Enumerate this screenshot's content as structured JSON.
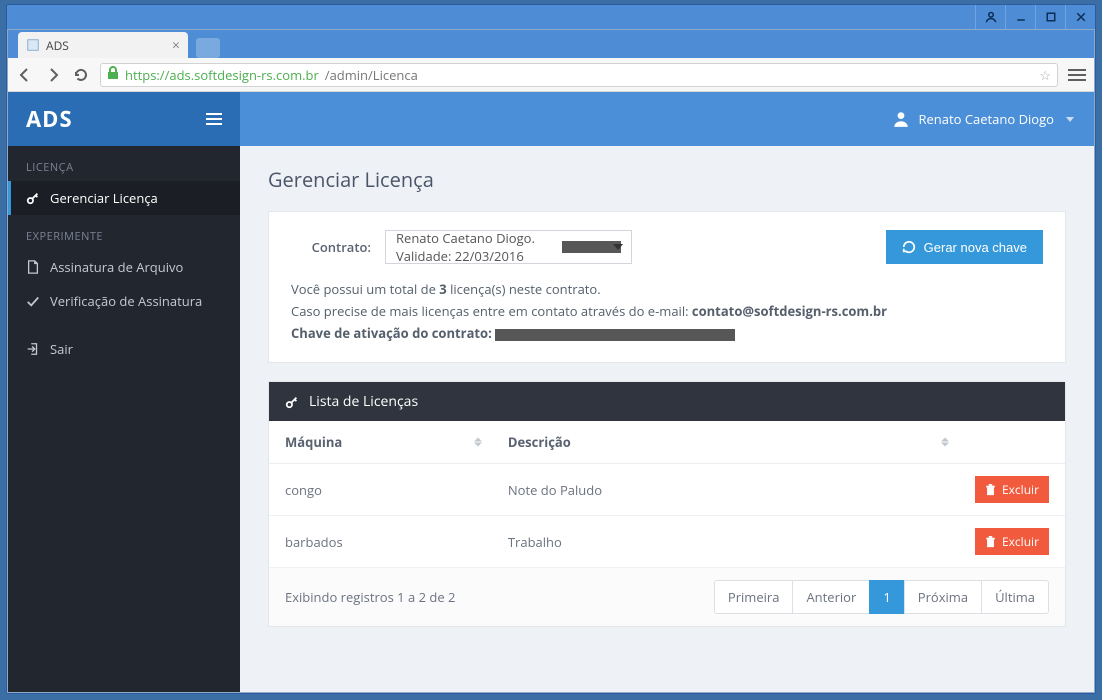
{
  "browser": {
    "tab_title": "ADS",
    "url_scheme": "https://",
    "url_host": "ads.softdesign-rs.com.br",
    "url_path": "/admin/Licenca"
  },
  "brand": "ADS",
  "user_name": "Renato Caetano Diogo",
  "sidebar": {
    "group1_title": "LICENÇA",
    "item_gerenciar": "Gerenciar Licença",
    "group2_title": "EXPERIMENTE",
    "item_assinatura": "Assinatura de Arquivo",
    "item_verificacao": "Verificação de Assinatura",
    "item_sair": "Sair"
  },
  "page": {
    "title": "Gerenciar Licença",
    "contract_label": "Contrato:",
    "contract_value": "Renato Caetano Diogo. Validade: 22/03/2016",
    "btn_generate": "Gerar nova chave",
    "info_total_prefix": "Você possui um total de ",
    "info_total_count": "3",
    "info_total_suffix": " licença(s) neste contrato.",
    "info_contact_prefix": "Caso precise de mais licenças entre em contato através do e-mail: ",
    "info_contact_email": "contato@softdesign-rs.com.br",
    "info_key_label": "Chave de ativação do contrato: "
  },
  "list": {
    "title": "Lista de Licenças",
    "col_machine": "Máquina",
    "col_description": "Descrição",
    "rows": [
      {
        "machine": "congo",
        "description": "Note do Paludo"
      },
      {
        "machine": "barbados",
        "description": "Trabalho"
      }
    ],
    "btn_delete": "Excluir",
    "footer_info": "Exibindo registros 1 a 2 de 2",
    "pager": {
      "first": "Primeira",
      "prev": "Anterior",
      "page": "1",
      "next": "Próxima",
      "last": "Última"
    }
  }
}
